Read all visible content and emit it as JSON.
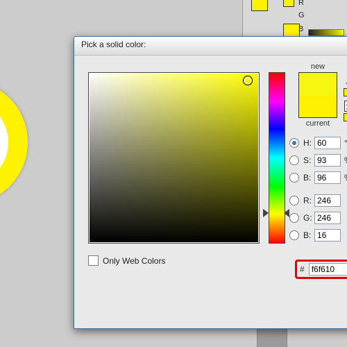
{
  "dialog": {
    "title": "Pick a solid color:"
  },
  "preview": {
    "new_label": "new",
    "current_label": "current",
    "new_color": "#f6f610",
    "current_color": "#fff200"
  },
  "hsb": {
    "h": {
      "label": "H:",
      "value": "60",
      "unit": "°",
      "checked": true
    },
    "s": {
      "label": "S:",
      "value": "93",
      "unit": "%",
      "checked": false
    },
    "b": {
      "label": "B:",
      "value": "96",
      "unit": "%",
      "checked": false
    }
  },
  "rgb": {
    "r": {
      "label": "R:",
      "value": "246",
      "checked": false
    },
    "g": {
      "label": "G:",
      "value": "246",
      "checked": false
    },
    "b": {
      "label": "B:",
      "value": "16",
      "checked": false
    }
  },
  "hex": {
    "prefix": "#",
    "value": "f6f610"
  },
  "only_web_colors": {
    "label": "Only Web Colors",
    "checked": false
  },
  "sv_cursor": {
    "x_pct": 93,
    "y_pct": 4
  },
  "hue_slider_pct": 83,
  "palette": {
    "letters": [
      "R",
      "G",
      "B"
    ]
  }
}
